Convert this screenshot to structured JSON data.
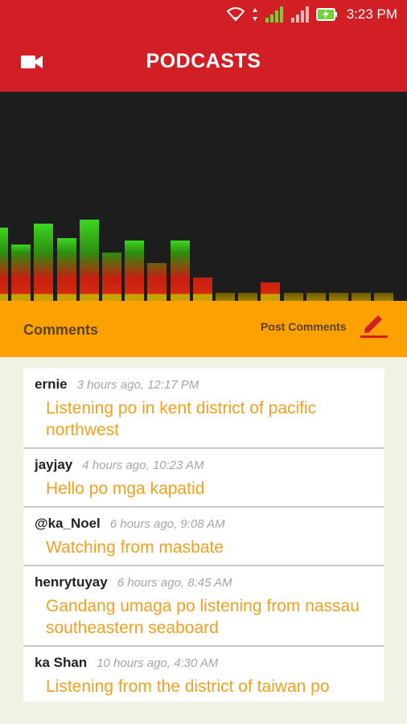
{
  "status_bar": {
    "time": "3:23 PM",
    "icons": [
      "wifi-icon",
      "data-transfer-icon",
      "signal-icon",
      "signal-icon",
      "battery-charging-icon"
    ]
  },
  "app_bar": {
    "title": "PODCASTS",
    "left_icon": "video-camera-icon"
  },
  "visualizer": {
    "levels": [
      0.35,
      0.27,
      0.37,
      0.3,
      0.39,
      0.23,
      0.29,
      0.18,
      0.29,
      0.11,
      0.04,
      0.04,
      0.09,
      0.04,
      0.04,
      0.04,
      0.04,
      0.04
    ]
  },
  "comments_header": {
    "label": "Comments",
    "post_label": "Post Comments",
    "post_icon": "pencil-icon"
  },
  "comments": [
    {
      "user": "ernie",
      "time": "3 hours ago, 12:17 PM",
      "text": "Listening po in kent district of pacific northwest"
    },
    {
      "user": "jayjay",
      "time": "4 hours ago, 10:23 AM",
      "text": "Hello po mga kapatid"
    },
    {
      "user": "@ka_Noel",
      "time": "6 hours ago, 9:08 AM",
      "text": "Watching from masbate"
    },
    {
      "user": "henrytuyay",
      "time": "6 hours ago, 8:45 AM",
      "text": "Gandang umaga po listening from nassau southeastern seaboard"
    },
    {
      "user": "ka Shan",
      "time": "10 hours ago, 4:30 AM",
      "text": "Listening from the district of taiwan po"
    }
  ],
  "colors": {
    "primary": "#d21f26",
    "accent": "#fda103",
    "comment_text": "#f2a01f"
  }
}
